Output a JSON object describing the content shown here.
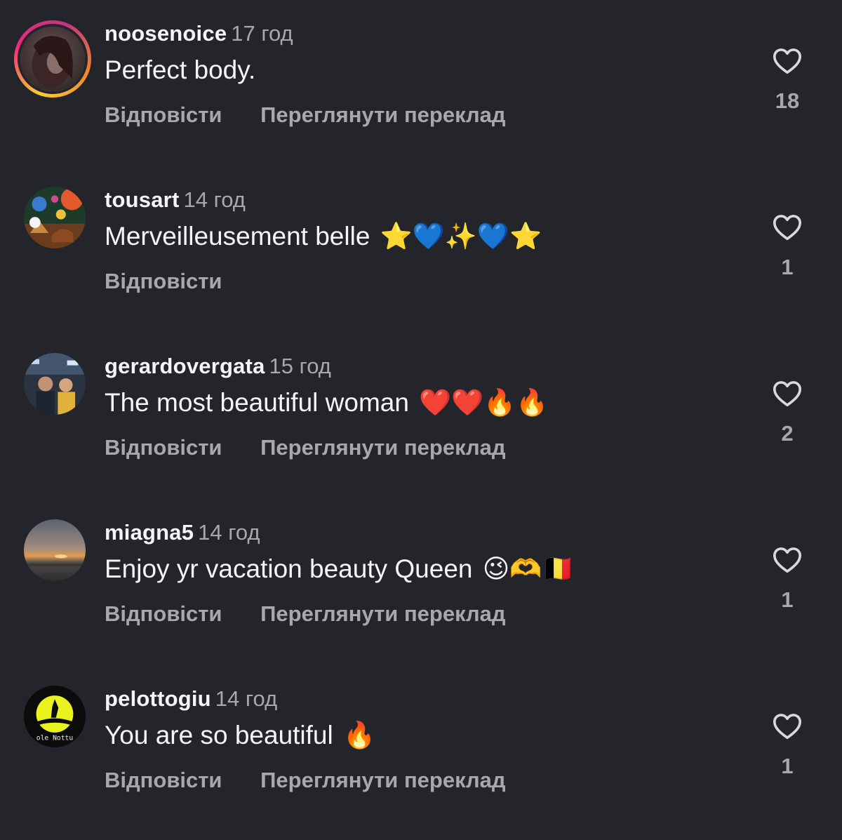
{
  "comments": [
    {
      "username": "noosenoice",
      "time": "17 год",
      "text": "Perfect body.",
      "emojis": "",
      "reply_label": "Відповісти",
      "translate_label": "Переглянути переклад",
      "likes": "18",
      "avatar": "profile-photo-icon"
    },
    {
      "username": "tousart",
      "time": "14 год",
      "text": "Merveilleusement belle",
      "emojis": "⭐💙✨💙⭐",
      "reply_label": "Відповісти",
      "translate_label": "",
      "likes": "1",
      "avatar": "painting-avatar-icon"
    },
    {
      "username": "gerardovergata",
      "time": "15 год",
      "text": "The most beautiful woman",
      "emojis": "❤️❤️🔥🔥",
      "reply_label": "Відповісти",
      "translate_label": "Переглянути переклад",
      "likes": "2",
      "avatar": "people-photo-avatar-icon"
    },
    {
      "username": "miagna5",
      "time": "14 год",
      "text": "Enjoy yr vacation beauty Queen",
      "emojis": "😉🫶🇧🇪",
      "reply_label": "Відповісти",
      "translate_label": "Переглянути переклад",
      "likes": "1",
      "avatar": "sunset-avatar-icon"
    },
    {
      "username": "pelottogiu",
      "time": "14 год",
      "text": "You are so beautiful",
      "emojis": "🔥",
      "reply_label": "Відповісти",
      "translate_label": "Переглянути переклад",
      "likes": "1",
      "avatar": "logo-avatar-icon",
      "avatar_text": "ole Nottu"
    }
  ],
  "colors": {
    "background": "#23252b",
    "primary_text": "#f5f5f5",
    "secondary_text": "#a7a8ad",
    "story_ring": "#ee2a7b"
  }
}
